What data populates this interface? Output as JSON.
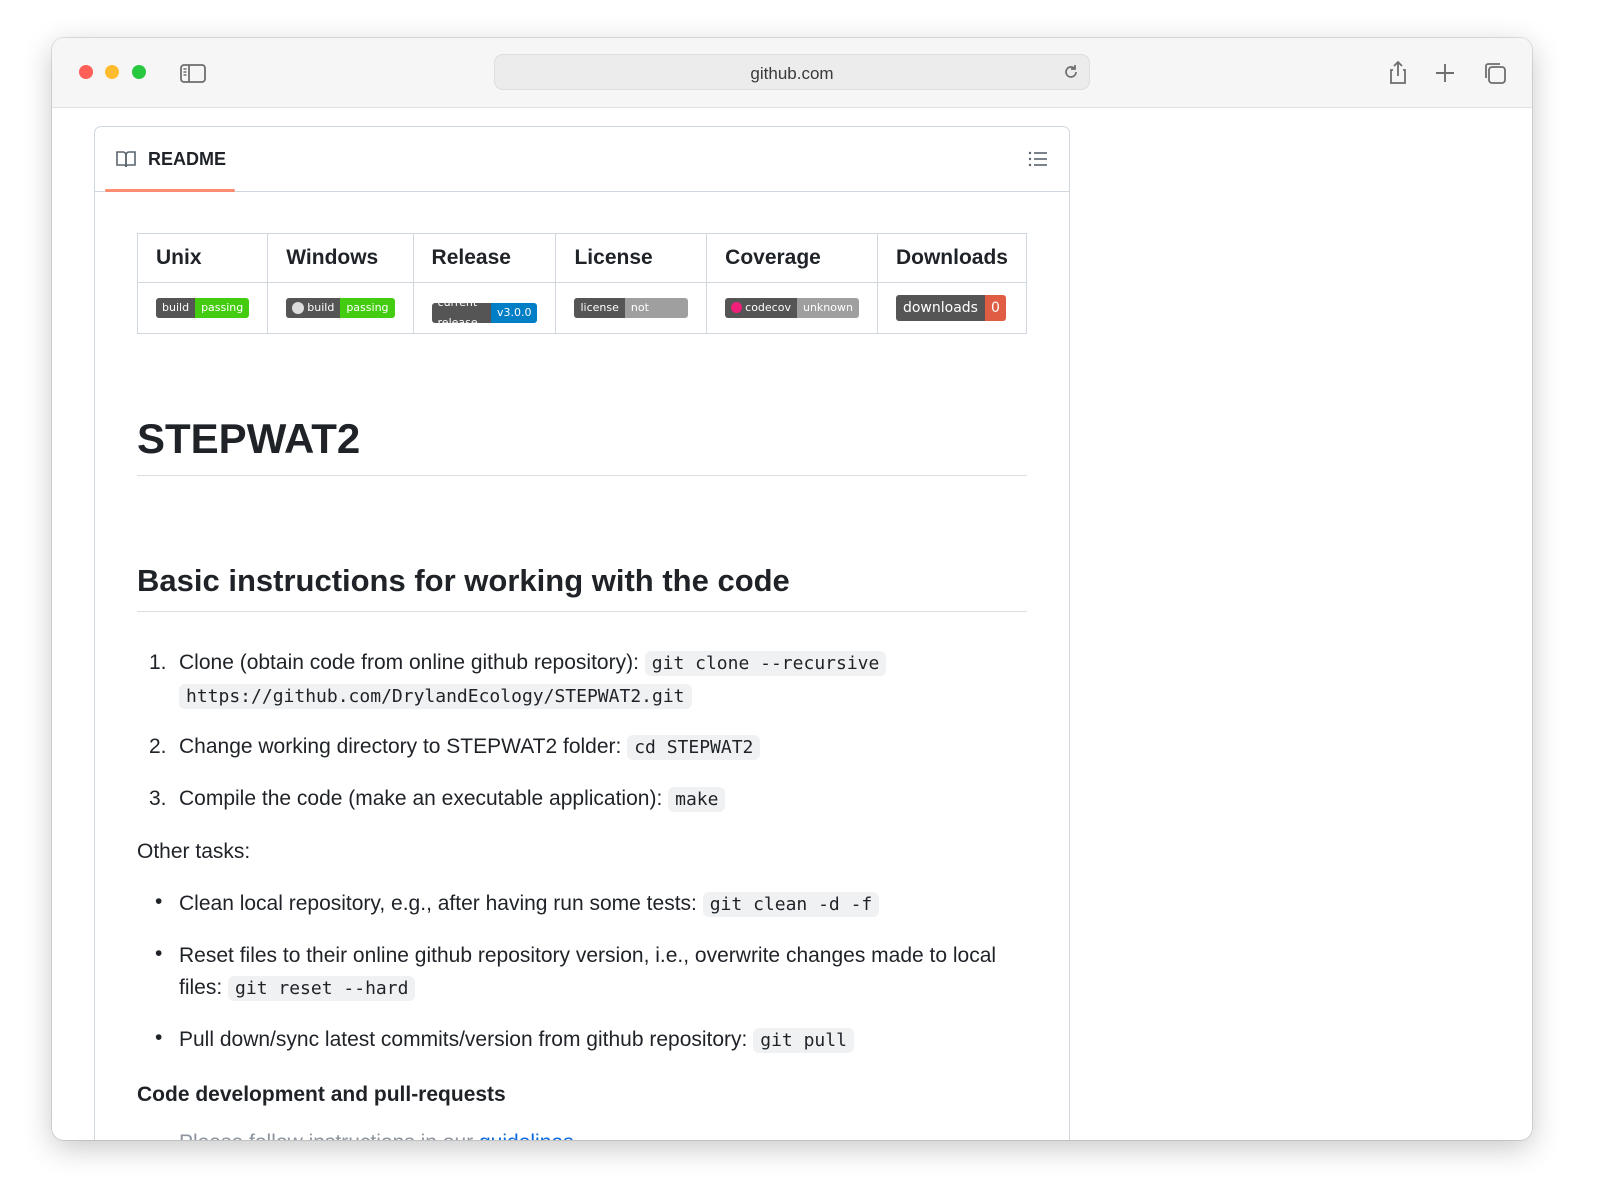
{
  "browser": {
    "url": "github.com"
  },
  "readme": {
    "tab_label": "README"
  },
  "badges_table": {
    "headers": [
      "Unix",
      "Windows",
      "Release",
      "License",
      "Coverage",
      "Downloads"
    ],
    "badges": [
      {
        "left": "build",
        "right": "passing",
        "color": "#44cc11"
      },
      {
        "left": "build",
        "right": "passing",
        "color": "#44cc11"
      },
      {
        "left": "current release",
        "right": "v3.0.0",
        "color": "#007ec6"
      },
      {
        "left": "license",
        "right": "not specified",
        "color": "#9f9f9f"
      },
      {
        "left": "codecov",
        "right": "unknown",
        "color": "#9f9f9f"
      },
      {
        "left": "downloads",
        "right": "0",
        "color": "#e05d44"
      }
    ]
  },
  "content": {
    "title": "STEPWAT2",
    "section_heading": "Basic instructions for working with the code",
    "steps": [
      {
        "num": "1.",
        "text": "Clone (obtain code from online github repository):",
        "code_a": "git clone --recursive",
        "code_b": "https://github.com/DrylandEcology/STEPWAT2.git"
      },
      {
        "num": "2.",
        "text": "Change working directory to STEPWAT2 folder:",
        "code": "cd STEPWAT2"
      },
      {
        "num": "3.",
        "text": "Compile the code (make an executable application):",
        "code": "make"
      }
    ],
    "other_tasks": "Other tasks:",
    "tasks": [
      {
        "text": "Clean local repository, e.g., after having run some tests:",
        "code": "git clean -d -f"
      },
      {
        "text_a": "Reset files to their online github repository version, i.e., overwrite changes made to local",
        "text_b": "files:",
        "code": "git reset --hard"
      },
      {
        "text": "Pull down/sync latest commits/version from github repository:",
        "code": "git pull"
      }
    ],
    "subsection_heading": "Code development and pull-requests",
    "cut_line_text": "Please follow instructions in our",
    "cut_line_link": "guidelines"
  }
}
